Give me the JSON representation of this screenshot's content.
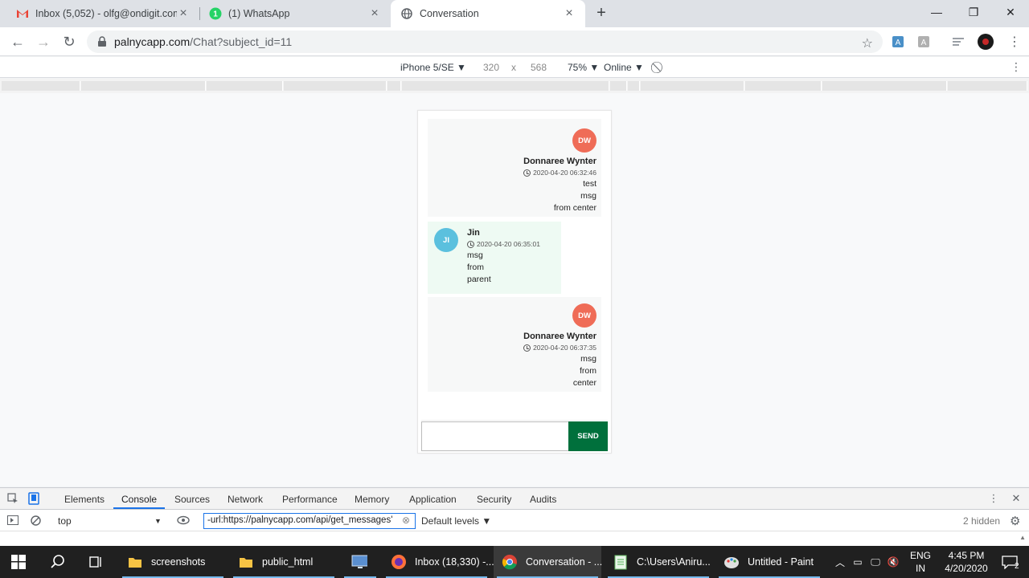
{
  "browser": {
    "tabs": [
      {
        "title": "Inbox (5,052) - olfg@ondigit.com",
        "icon": "gmail-icon"
      },
      {
        "title": "(1) WhatsApp",
        "icon": "whatsapp-icon"
      },
      {
        "title": "Conversation",
        "icon": "globe-icon",
        "active": true
      }
    ],
    "address": {
      "host": "palnycapp.com",
      "path": "/Chat?subject_id=11"
    }
  },
  "device_toolbar": {
    "device": "iPhone 5/SE ▼",
    "width": "320",
    "times": "x",
    "height": "568",
    "zoom": "75% ▼",
    "network": "Online ▼"
  },
  "chat": {
    "messages": [
      {
        "side": "right",
        "initials": "DW",
        "name": "Donnaree Wynter",
        "time": "2020-04-20 06:32:46",
        "lines": [
          "test",
          "msg",
          "from center"
        ],
        "avatar_color": "#ef6c57"
      },
      {
        "side": "left",
        "initials": "JI",
        "name": "Jin",
        "time": "2020-04-20 06:35:01",
        "lines": [
          "msg",
          "from",
          "parent"
        ],
        "avatar_color": "#5bc0de"
      },
      {
        "side": "right",
        "initials": "DW",
        "name": "Donnaree Wynter",
        "time": "2020-04-20 06:37:35",
        "lines": [
          "msg",
          "from",
          "center"
        ],
        "avatar_color": "#ef6c57"
      }
    ],
    "input_value": "",
    "send_label": "SEND"
  },
  "devtools": {
    "tabs": [
      "Elements",
      "Console",
      "Sources",
      "Network",
      "Performance",
      "Memory",
      "Application",
      "Security",
      "Audits"
    ],
    "active_tab": "Console",
    "context": "top",
    "filter": "-url:https://palnycapp.com/api/get_messages'",
    "levels": "Default levels ▼",
    "hidden": "2 hidden"
  },
  "taskbar": {
    "items": [
      {
        "label": "screenshots",
        "icon": "folder-icon"
      },
      {
        "label": "public_html",
        "icon": "folder-icon"
      },
      {
        "label": "",
        "icon": "remote-desktop-icon"
      },
      {
        "label": "Inbox (18,330) -...",
        "icon": "firefox-icon"
      },
      {
        "label": "Conversation - ...",
        "icon": "chrome-icon"
      },
      {
        "label": "C:\\Users\\Aniru...",
        "icon": "notepad-icon"
      },
      {
        "label": "Untitled - Paint",
        "icon": "paint-icon"
      }
    ],
    "lang": "ENG",
    "region": "IN",
    "time": "4:45 PM",
    "date": "4/20/2020",
    "notifications": "2"
  }
}
